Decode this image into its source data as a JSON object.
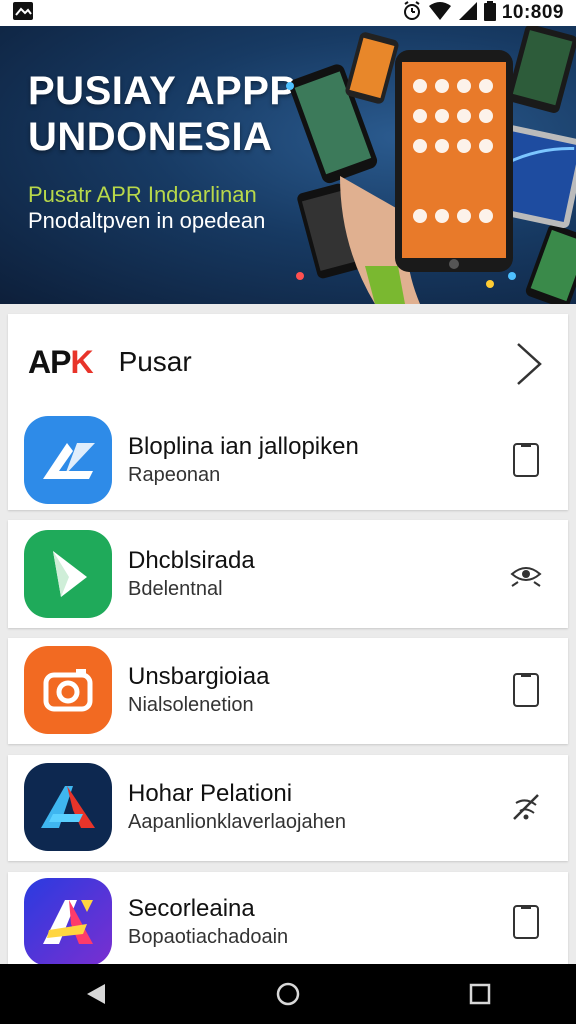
{
  "status_bar": {
    "time": "10:809",
    "notification_icon": "gallery-icon",
    "alarm_icon": "alarm-icon",
    "wifi_icon": "wifi-icon",
    "signal_icon": "signal-icon",
    "battery_icon": "battery-icon"
  },
  "banner": {
    "title_line1": "PUSIAY APPP",
    "title_line2": "UNDONESIA",
    "subtitle_line1": "Pusatr APR Indoarlinan",
    "subtitle_line2": "Pnodaltpven in opedean"
  },
  "header": {
    "logo_text_main": "AP",
    "logo_text_accent": "K",
    "title": "Pusar",
    "chevron_icon": "chevron-right-icon"
  },
  "apps": [
    {
      "name": "Bloplina ian jallopiken",
      "subtitle": "Rapeonan",
      "icon": "app-store-icon",
      "action_icon": "phone-outline-icon",
      "color": "#2e8be8"
    },
    {
      "name": "Dhcblsirada",
      "subtitle": "Bdelentnal",
      "icon": "play-arrow-icon",
      "action_icon": "eye-scan-icon",
      "color": "#1faa5a"
    },
    {
      "name": "Unsbargioiaa",
      "subtitle": "Nialsolenetion",
      "icon": "camera-icon",
      "action_icon": "phone-outline-icon",
      "color": "#f26a22"
    },
    {
      "name": "Hohar Pelationi",
      "subtitle": "Aapanlionklaverlaojahen",
      "icon": "blue-a-icon",
      "action_icon": "no-signal-icon",
      "color": "#0d2850"
    },
    {
      "name": "Secorleaina",
      "subtitle": "Bopaotiachadoain",
      "icon": "gradient-a-icon",
      "action_icon": "phone-outline-icon",
      "color": "#3a2fd6"
    }
  ],
  "nav_bar": {
    "back_icon": "back-triangle-icon",
    "home_icon": "home-circle-icon",
    "recents_icon": "recents-square-icon"
  }
}
